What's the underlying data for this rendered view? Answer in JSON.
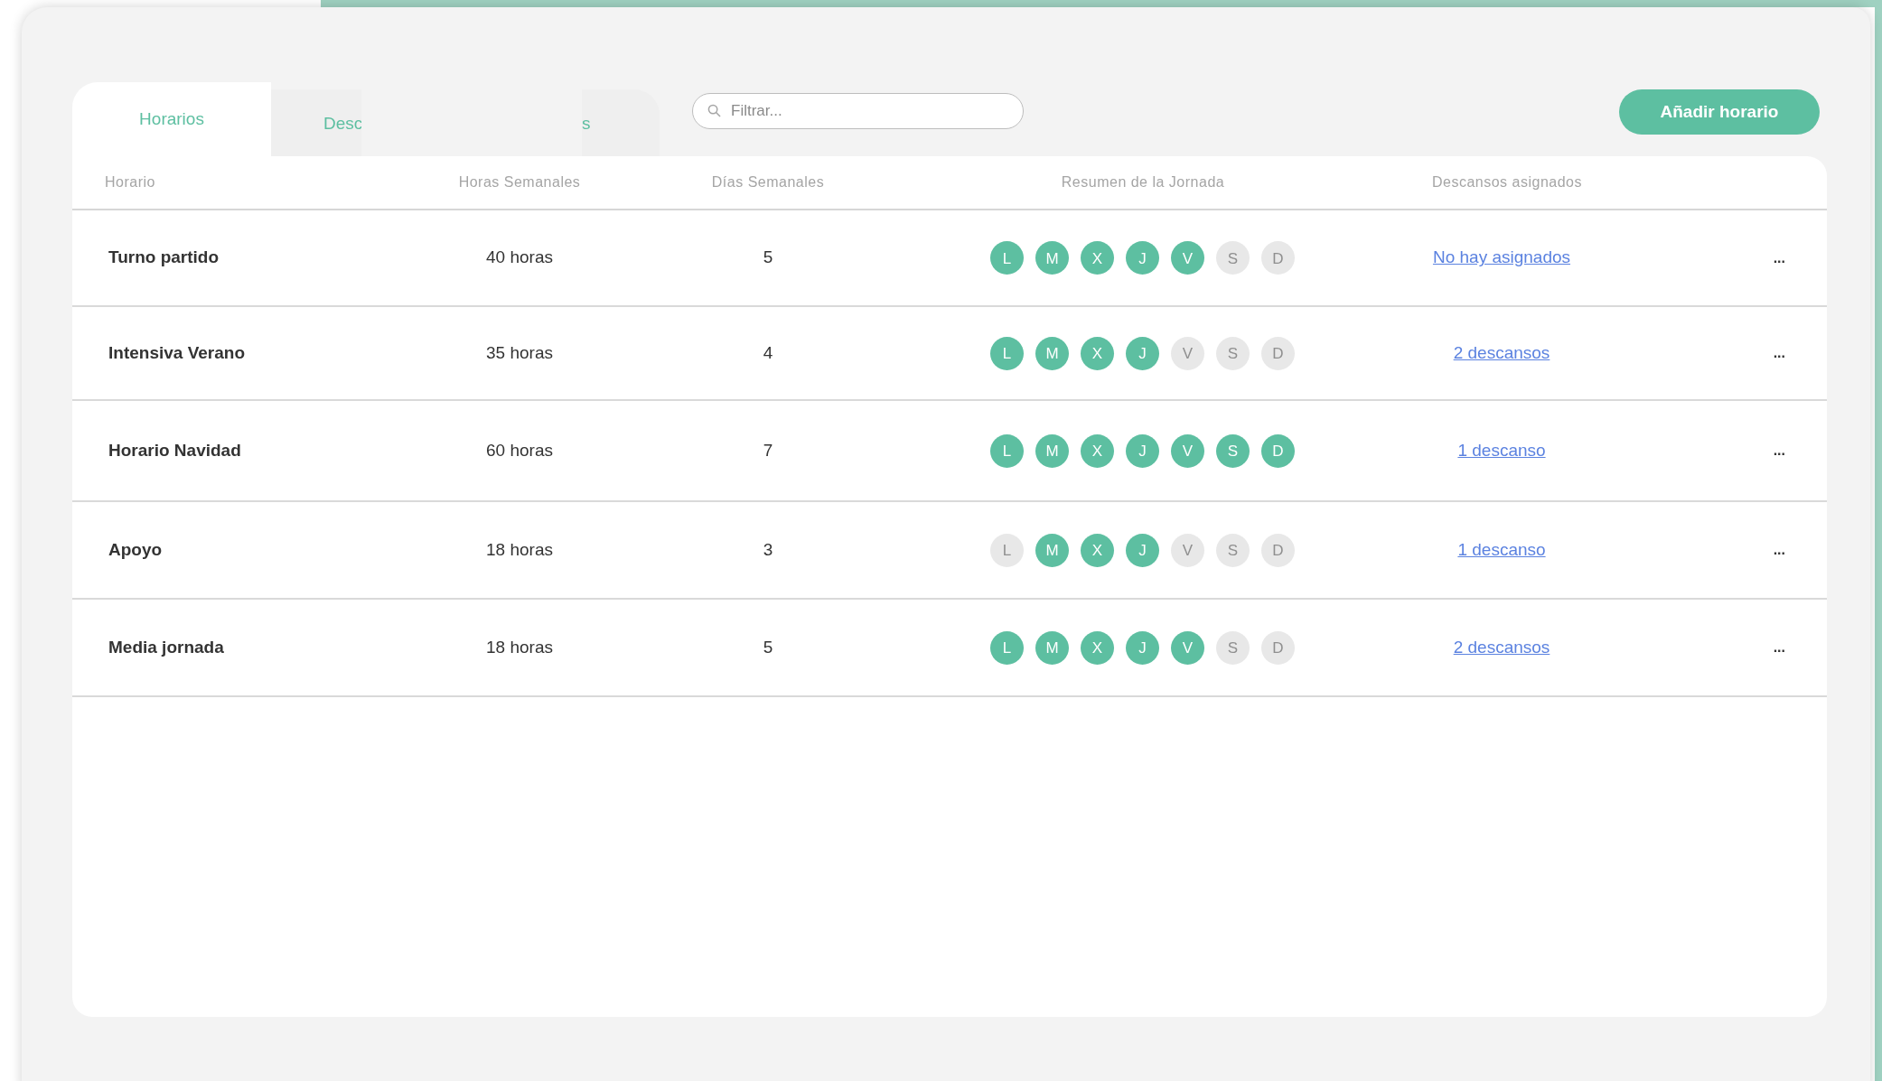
{
  "tabs": [
    {
      "label": "Horarios",
      "selected": true
    },
    {
      "label_start": "Desc",
      "label_end": "s",
      "selected": false
    }
  ],
  "search": {
    "placeholder": "Filtrar..."
  },
  "add_button": "Añadir horario",
  "table": {
    "columns": [
      "Horario",
      "Horas Semanales",
      "Días Semanales",
      "Resumen de la Jornada",
      "Descansos asignados"
    ],
    "rows": [
      {
        "name": "Turno partido",
        "hours": "40 horas",
        "days": "5",
        "week": [
          {
            "letter": "L",
            "on": true
          },
          {
            "letter": "M",
            "on": true
          },
          {
            "letter": "X",
            "on": true
          },
          {
            "letter": "J",
            "on": true
          },
          {
            "letter": "V",
            "on": true
          },
          {
            "letter": "S",
            "on": false
          },
          {
            "letter": "D",
            "on": false
          }
        ],
        "breaks": "No hay asignados",
        "menu": "..."
      },
      {
        "name": "Intensiva Verano",
        "hours": "35 horas",
        "days": "4",
        "week": [
          {
            "letter": "L",
            "on": true
          },
          {
            "letter": "M",
            "on": true
          },
          {
            "letter": "X",
            "on": true
          },
          {
            "letter": "J",
            "on": true
          },
          {
            "letter": "V",
            "on": false
          },
          {
            "letter": "S",
            "on": false
          },
          {
            "letter": "D",
            "on": false
          }
        ],
        "breaks": "2 descansos",
        "menu": "..."
      },
      {
        "name": "Horario Navidad",
        "hours": "60 horas",
        "days": "7",
        "week": [
          {
            "letter": "L",
            "on": true
          },
          {
            "letter": "M",
            "on": true
          },
          {
            "letter": "X",
            "on": true
          },
          {
            "letter": "J",
            "on": true
          },
          {
            "letter": "V",
            "on": true
          },
          {
            "letter": "S",
            "on": true
          },
          {
            "letter": "D",
            "on": true
          }
        ],
        "breaks": "1 descanso",
        "menu": "..."
      },
      {
        "name": "Apoyo",
        "hours": "18 horas",
        "days": "3",
        "week": [
          {
            "letter": "L",
            "on": false
          },
          {
            "letter": "M",
            "on": true
          },
          {
            "letter": "X",
            "on": true
          },
          {
            "letter": "J",
            "on": true
          },
          {
            "letter": "V",
            "on": false
          },
          {
            "letter": "S",
            "on": false
          },
          {
            "letter": "D",
            "on": false
          }
        ],
        "breaks": "1 descanso",
        "menu": "..."
      },
      {
        "name": "Media jornada",
        "hours": "18 horas",
        "days": "5",
        "week": [
          {
            "letter": "L",
            "on": true
          },
          {
            "letter": "M",
            "on": true
          },
          {
            "letter": "X",
            "on": true
          },
          {
            "letter": "J",
            "on": true
          },
          {
            "letter": "V",
            "on": true
          },
          {
            "letter": "S",
            "on": false
          },
          {
            "letter": "D",
            "on": false
          }
        ],
        "breaks": "2 descansos",
        "menu": "..."
      }
    ]
  }
}
